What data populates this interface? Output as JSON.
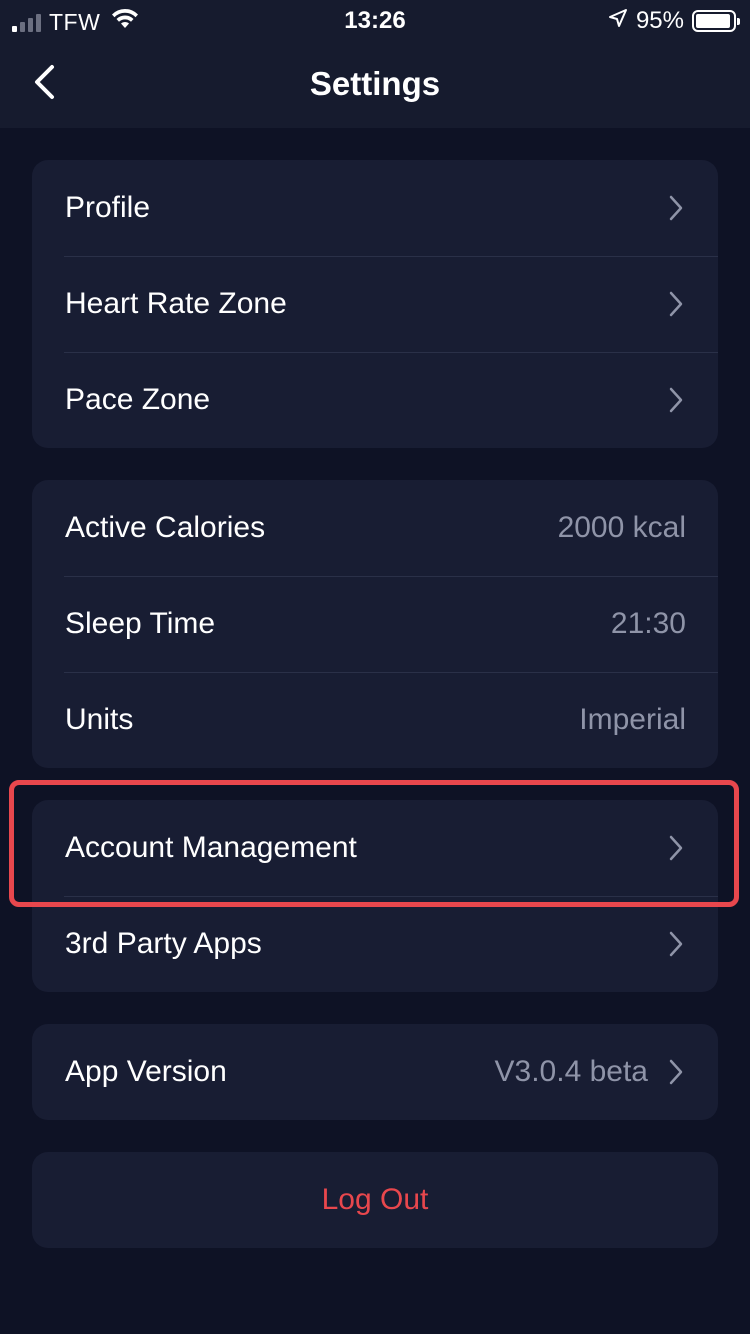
{
  "status_bar": {
    "carrier": "TFW",
    "time": "13:26",
    "battery": "95%",
    "signal_bars_active": 1,
    "signal_bars_total": 4
  },
  "nav": {
    "title": "Settings",
    "back_icon": "chevron-left-icon"
  },
  "groups": [
    {
      "rows": [
        {
          "label": "Profile",
          "chevron": true
        },
        {
          "label": "Heart Rate Zone",
          "chevron": true
        },
        {
          "label": "Pace Zone",
          "chevron": true
        }
      ]
    },
    {
      "rows": [
        {
          "label": "Active Calories",
          "value": "2000 kcal"
        },
        {
          "label": "Sleep Time",
          "value": "21:30"
        },
        {
          "label": "Units",
          "value": "Imperial"
        }
      ]
    },
    {
      "rows": [
        {
          "label": "Account Management",
          "chevron": true,
          "highlighted": true
        },
        {
          "label": "3rd Party Apps",
          "chevron": true
        }
      ]
    },
    {
      "rows": [
        {
          "label": "App Version",
          "value": "V3.0.4 beta",
          "chevron": true
        }
      ]
    }
  ],
  "logout": {
    "label": "Log Out"
  },
  "colors": {
    "background": "#0e1225",
    "card": "#181d33",
    "header": "#161b2e",
    "value_text": "#8f94a8",
    "logout_text": "#e8474d",
    "highlight": "#e8474d"
  }
}
